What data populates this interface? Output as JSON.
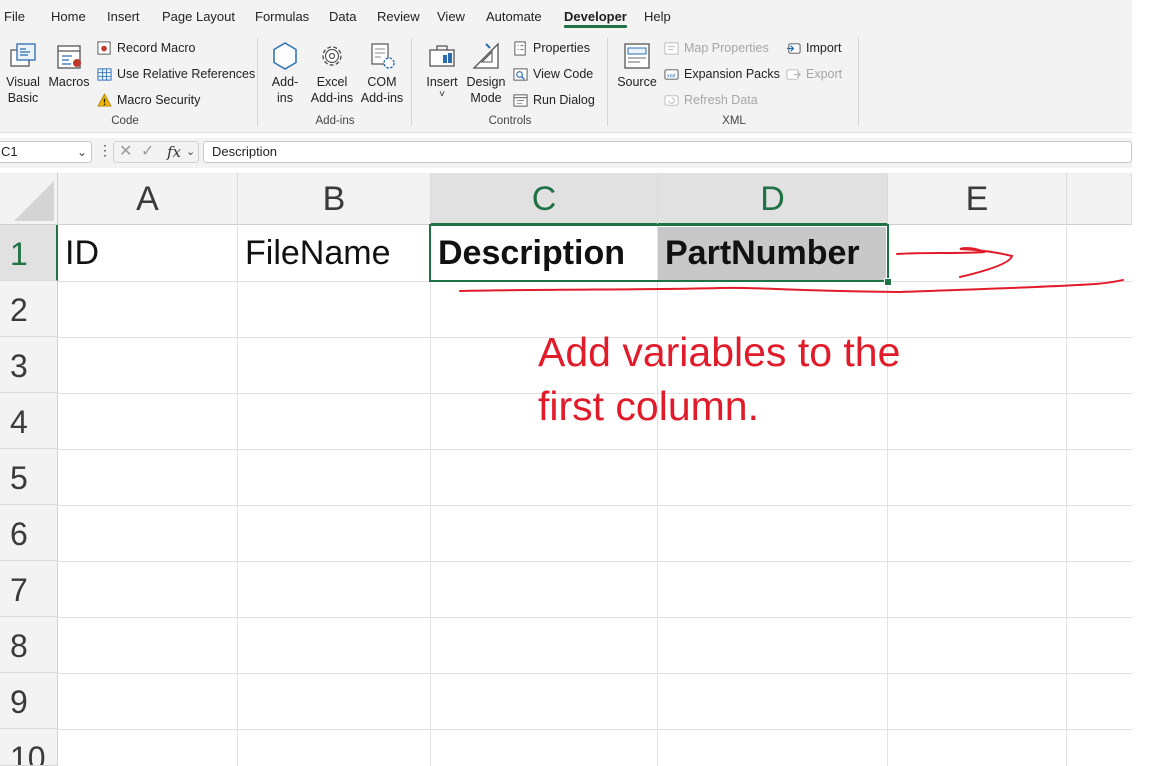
{
  "menu": {
    "tabs": [
      "File",
      "Home",
      "Insert",
      "Page Layout",
      "Formulas",
      "Data",
      "Review",
      "View",
      "Automate",
      "Developer",
      "Help"
    ],
    "active": "Developer"
  },
  "ribbon": {
    "code": {
      "visual_basic": "Visual Basic",
      "vb_l1": "Visual",
      "vb_l2": "Basic",
      "macros": "Macros",
      "record_macro": "Record Macro",
      "use_relative": "Use Relative References",
      "macro_security": "Macro Security",
      "label": "Code"
    },
    "addins": {
      "addins_l1": "Add-",
      "addins_l2": "ins",
      "excel_l1": "Excel",
      "excel_l2": "Add-ins",
      "com_l1": "COM",
      "com_l2": "Add-ins",
      "label": "Add-ins"
    },
    "controls": {
      "insert": "Insert",
      "insert_arrow": "˅",
      "design_l1": "Design",
      "design_l2": "Mode",
      "properties": "Properties",
      "view_code": "View Code",
      "run_dialog": "Run Dialog",
      "label": "Controls"
    },
    "xml": {
      "source": "Source",
      "map_properties": "Map Properties",
      "expansion_packs": "Expansion Packs",
      "refresh_data": "Refresh Data",
      "import": "Import",
      "export": "Export",
      "label": "XML"
    }
  },
  "formula_bar": {
    "name_box": "C1",
    "fx": "fx",
    "content": "Description"
  },
  "grid": {
    "columns": [
      "A",
      "B",
      "C",
      "D",
      "E"
    ],
    "rows": [
      "1",
      "2",
      "3",
      "4",
      "5",
      "6",
      "7",
      "8",
      "9",
      "10"
    ],
    "row1": {
      "A": "ID",
      "B": "FileName",
      "C": "Description",
      "D": "PartNumber"
    }
  },
  "annotation": {
    "line1": "Add variables to the",
    "line2": "first column.",
    "color": "#e21b2a"
  },
  "colors": {
    "accent": "#1f7244",
    "selected_cell_fill": "#c8c8c8"
  }
}
